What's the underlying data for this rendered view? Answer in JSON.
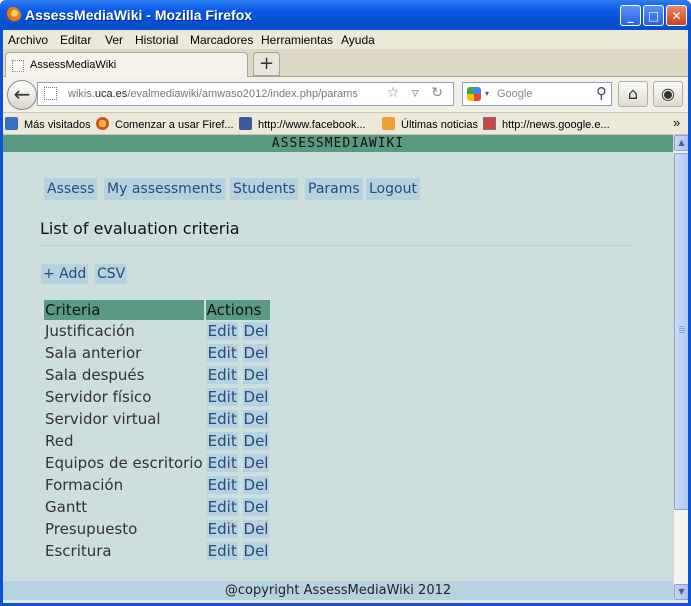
{
  "window": {
    "title": "AssessMediaWiki - Mozilla Firefox",
    "controls": {
      "minimize": "_",
      "maximize": "□",
      "close": "✕"
    }
  },
  "menubar": {
    "items": [
      "Archivo",
      "Editar",
      "Ver",
      "Historial",
      "Marcadores",
      "Herramientas",
      "Ayuda"
    ]
  },
  "tabs": [
    {
      "label": "AssessMediaWiki"
    }
  ],
  "newtab_label": "+",
  "navbar": {
    "url_prefix": "wikis.",
    "url_domain": "uca.es",
    "url_path": "/evalmediawiki/amwaso2012/index.php/params",
    "search_placeholder": "Google",
    "url_icons": "☆ ▿ ↻"
  },
  "bookmarks": [
    {
      "label": "Más visitados",
      "icon": "most-visited-icon"
    },
    {
      "label": "Comenzar a usar Firef...",
      "icon": "firefox-icon"
    },
    {
      "label": "http://www.facebook...",
      "icon": "facebook-icon"
    },
    {
      "label": "Últimas noticias",
      "icon": "rss-icon"
    },
    {
      "label": "http://news.google.e...",
      "icon": "news-icon"
    }
  ],
  "bookmarks_overflow": "»",
  "site": {
    "header": "ASSESSMEDIAWIKI",
    "nav": [
      "Assess",
      "My assessments",
      "Students",
      "Params",
      "Logout"
    ],
    "page_title": "List of evaluation criteria",
    "actions": {
      "add": "+ Add",
      "csv": "CSV"
    },
    "table": {
      "columns": [
        "Criteria",
        "Actions"
      ],
      "edit_label": "Edit",
      "del_label": "Del",
      "rows": [
        "Justificación",
        "Sala anterior",
        "Sala después",
        "Servidor físico",
        "Servidor virtual",
        "Red",
        "Equipos de escritorio",
        "Formación",
        "Gantt",
        "Presupuesto",
        "Escritura"
      ]
    },
    "footer": "@copyright AssessMediaWiki 2012"
  },
  "colors": {
    "header_bg": "#5a9a82",
    "page_bg": "#ccdfdc",
    "link_bg": "#b6d1e0",
    "link_text": "#2a4a7a"
  }
}
